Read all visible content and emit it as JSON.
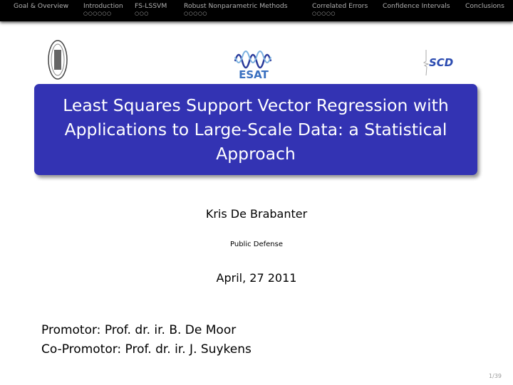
{
  "nav": {
    "items": [
      {
        "label": "Goal & Overview",
        "dots": ""
      },
      {
        "label": "Introduction",
        "dots": "○○○○○○"
      },
      {
        "label": "FS-LSSVM",
        "dots": "○○○"
      },
      {
        "label": "Robust Nonparametric Methods",
        "dots": "○○○○○"
      },
      {
        "label": "Correlated Errors",
        "dots": "○○○○○"
      },
      {
        "label": "Confidence Intervals",
        "dots": ""
      },
      {
        "label": "Conclusions",
        "dots": ""
      }
    ]
  },
  "logos": {
    "left": "university-seal",
    "center": "ESAT",
    "right": "SCD"
  },
  "title": "Least Squares Support Vector Regression with Applications to Large-Scale Data: a Statistical Approach",
  "author": "Kris De Brabanter",
  "institute": "Public Defense",
  "date": "April, 27 2011",
  "promotor": "Promotor: Prof. dr. ir. B. De Moor",
  "copromotor": "Co-Promotor: Prof. dr. ir. J. Suykens",
  "page": "1/39",
  "colors": {
    "title_box": "#3333b3",
    "nav_bg": "#000000"
  }
}
